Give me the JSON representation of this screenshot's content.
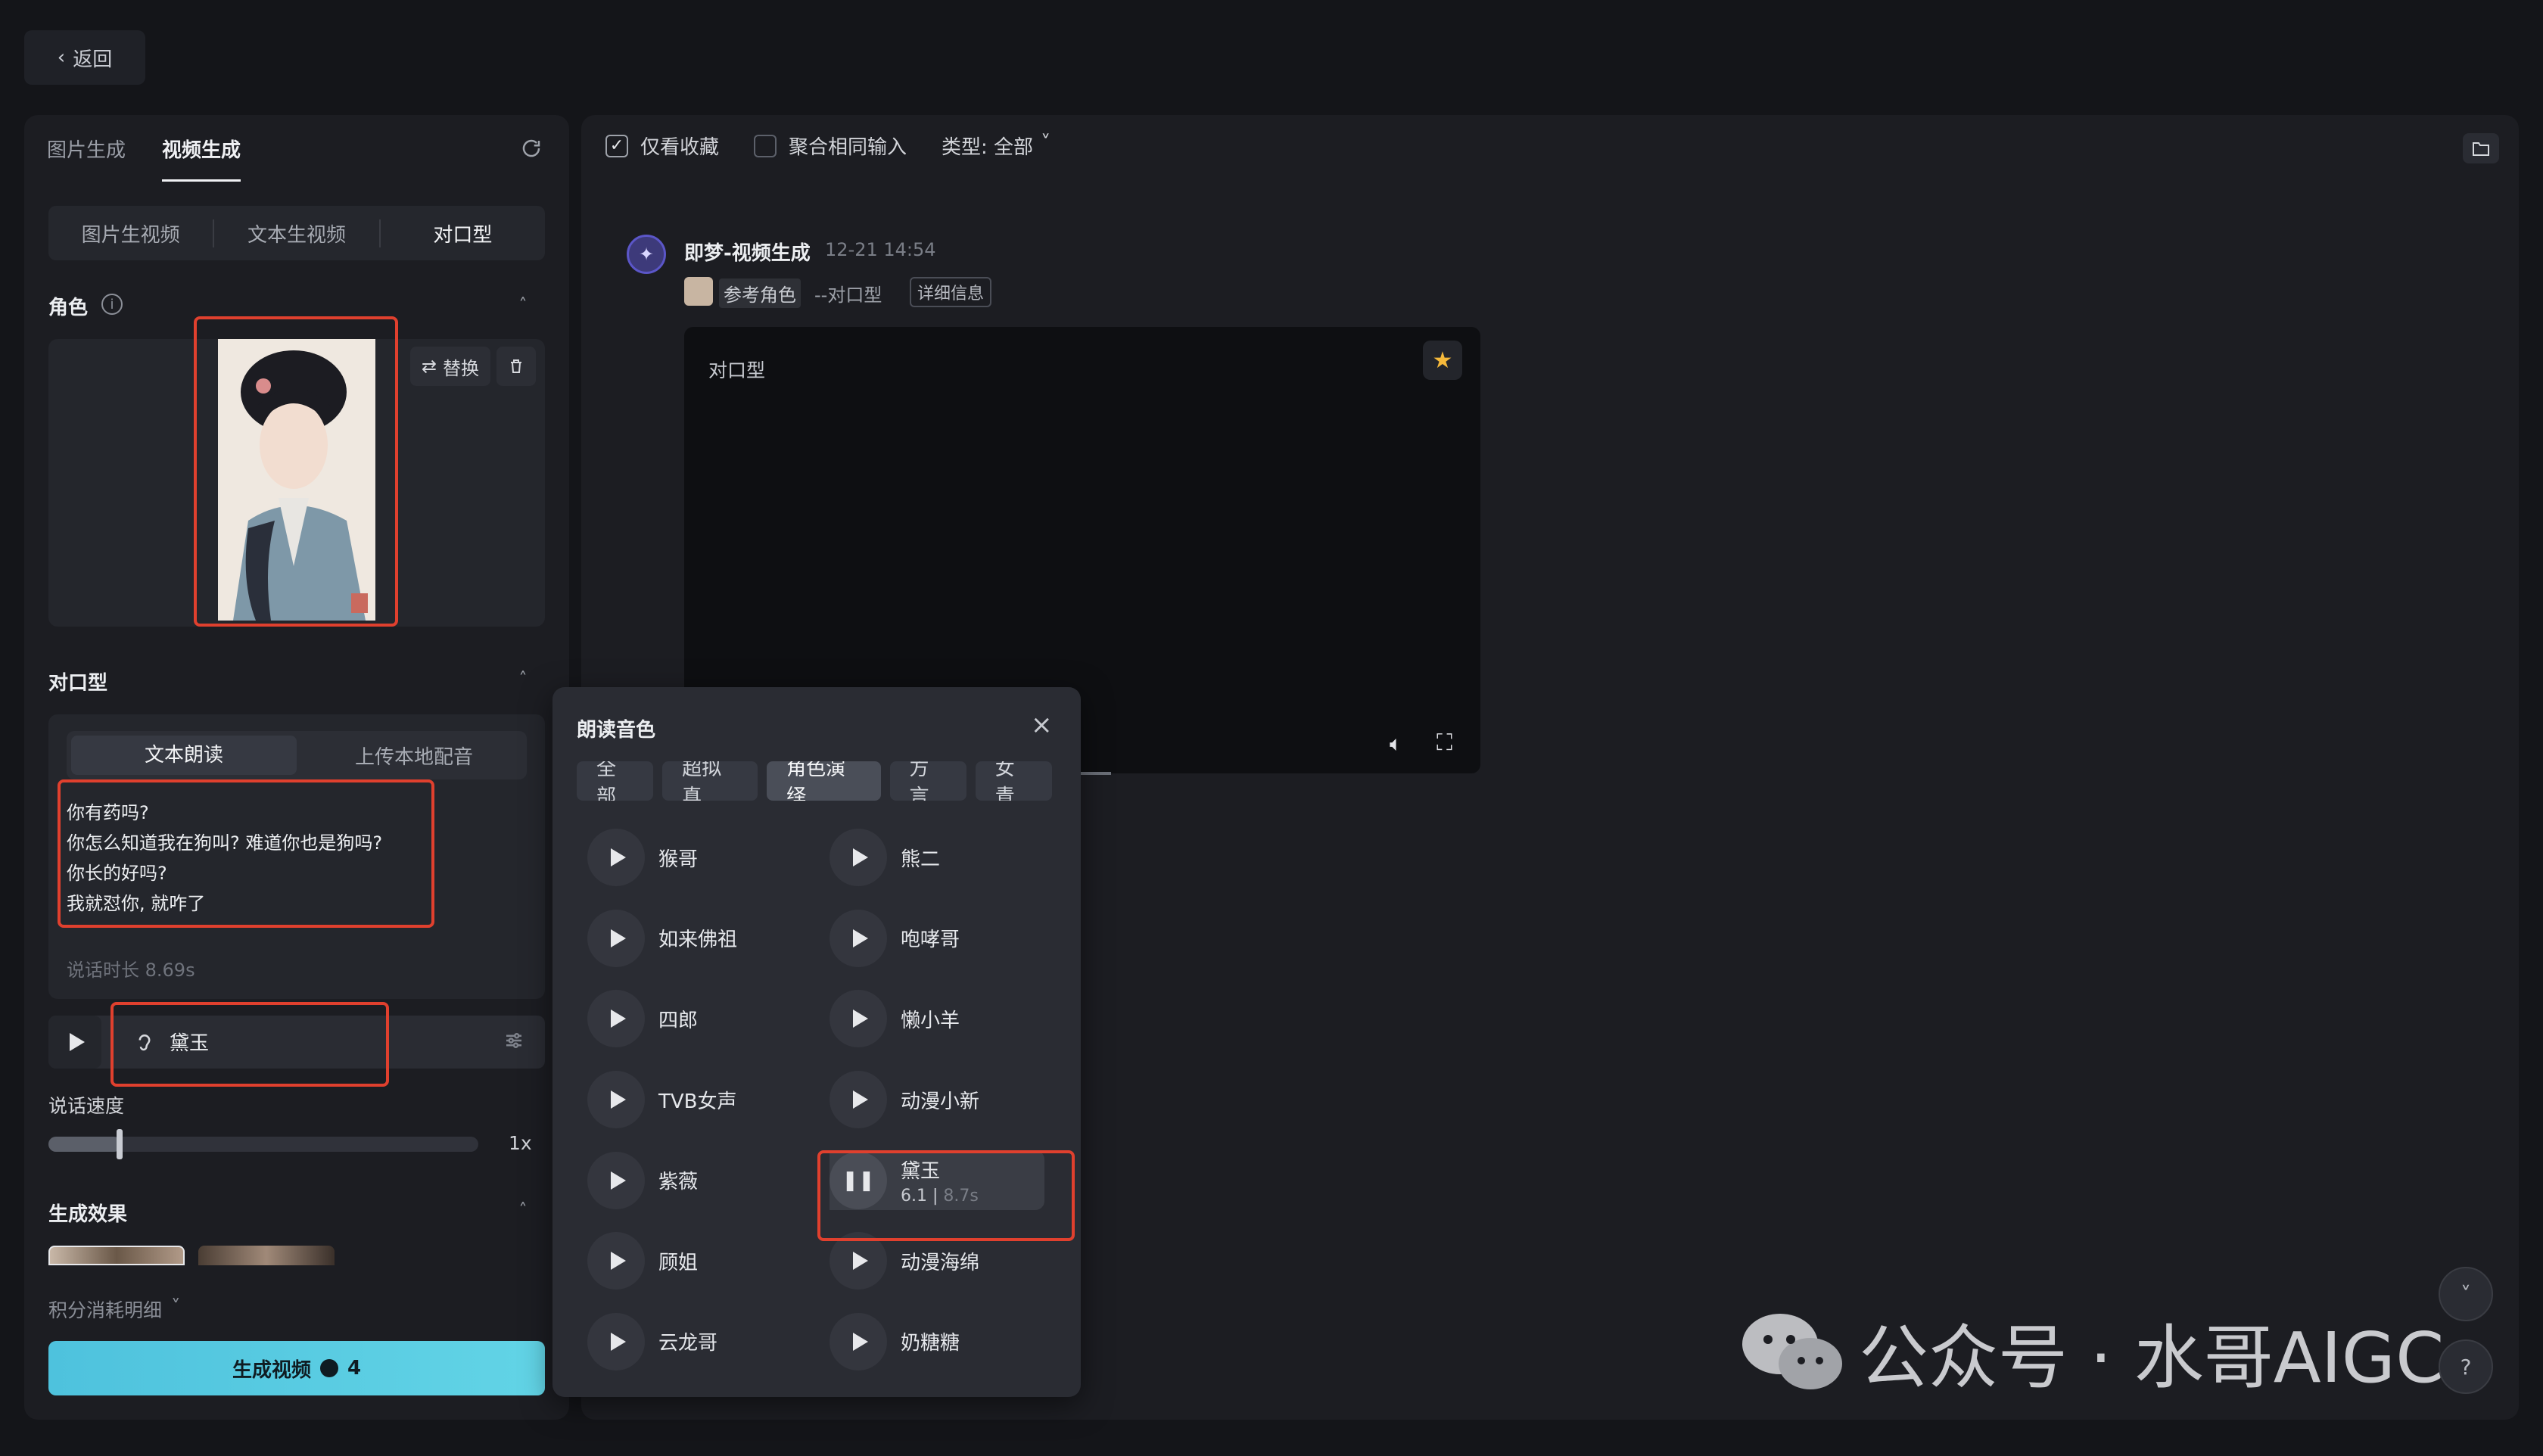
{
  "nav": {
    "back_label": "返回"
  },
  "left": {
    "tabs": [
      "图片生成",
      "视频生成"
    ],
    "active_tab": "视频生成",
    "modes": [
      "图片生视频",
      "文本生视频",
      "对口型"
    ],
    "active_mode": "对口型",
    "role_section": {
      "title": "角色",
      "info": "i",
      "replace_label": "替换"
    },
    "lipsync_section": {
      "title": "对口型",
      "tabs": [
        "文本朗读",
        "上传本地配音"
      ],
      "active_tab": "文本朗读",
      "lines": [
        "你有药吗?",
        "你怎么知道我在狗叫? 难道你也是狗吗?",
        "你长的好吗?",
        "我就怼你, 就咋了"
      ],
      "duration_text": "说话时长 8.69s"
    },
    "voice": {
      "name": "黛玉"
    },
    "speed": {
      "label": "说话速度",
      "value_text": "1x",
      "level": 0.17
    },
    "effect_section": {
      "title": "生成效果"
    },
    "points_label": "积分消耗明细",
    "generate": {
      "label": "生成视频",
      "cost": "4"
    }
  },
  "right": {
    "filters": {
      "fav_only": "仅看收藏",
      "merge_same": "聚合相同输入",
      "type_label": "类型: 全部"
    },
    "item": {
      "author": "即梦-视频生成",
      "time": "12-21  14:54",
      "ref_label": "参考角色",
      "mode_text": "--对口型",
      "detail_label": "详细信息",
      "video_title": "对口型"
    }
  },
  "popup": {
    "title": "朗读音色",
    "chips": [
      "全部",
      "超拟真",
      "角色演绎",
      "方言",
      "女青"
    ],
    "active_chip": "角色演绎",
    "left_voices": [
      "猴哥",
      "如来佛祖",
      "四郎",
      "TVB女声",
      "紫薇",
      "顾姐",
      "云龙哥"
    ],
    "right_voices": [
      "熊二",
      "咆哮哥",
      "懒小羊",
      "动漫小新",
      "黛玉",
      "动漫海绵",
      "奶糖糖"
    ],
    "selected": {
      "name": "黛玉",
      "progress": "6.1",
      "total": "8.7s"
    }
  },
  "watermark": {
    "text": "公众号 · 水哥AIGC"
  },
  "colors": {
    "accent": "#62d4e6",
    "highlight": "#e0402e",
    "star": "#f5b93b"
  }
}
